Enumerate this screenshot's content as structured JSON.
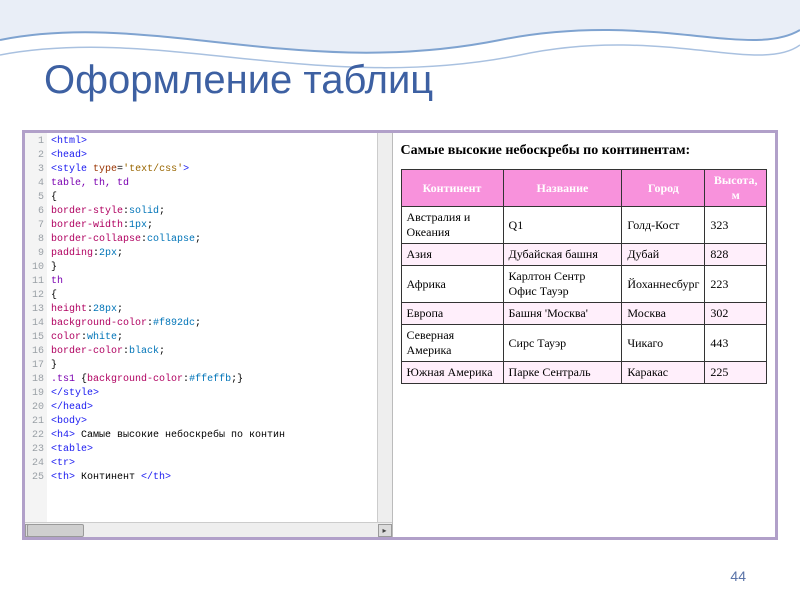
{
  "title": "Оформление таблиц",
  "page_number": "44",
  "code_lines": [
    {
      "n": "1",
      "html": "<span class='tag'>&lt;html&gt;</span>"
    },
    {
      "n": "2",
      "html": "<span class='tag'>&lt;head&gt;</span>"
    },
    {
      "n": "3",
      "html": "<span class='tag'>&lt;style</span> <span class='attr'>type</span>=<span class='str'>'text/css'</span><span class='tag'>&gt;</span>"
    },
    {
      "n": "4",
      "html": "<span class='sel'>table, th, td</span>"
    },
    {
      "n": "5",
      "html": "{"
    },
    {
      "n": "6",
      "html": "<span class='prop'>border-style</span>:<span class='val'>solid</span>;"
    },
    {
      "n": "7",
      "html": "<span class='prop'>border-width</span>:<span class='val'>1px</span>;"
    },
    {
      "n": "8",
      "html": "<span class='prop'>border-collapse</span>:<span class='val'>collapse</span>;"
    },
    {
      "n": "9",
      "html": "<span class='prop'>padding</span>:<span class='val'>2px</span>;"
    },
    {
      "n": "10",
      "html": "}"
    },
    {
      "n": "11",
      "html": "<span class='sel'>th</span>"
    },
    {
      "n": "12",
      "html": "{"
    },
    {
      "n": "13",
      "html": "<span class='prop'>height</span>:<span class='val'>28px</span>;"
    },
    {
      "n": "14",
      "html": "<span class='prop'>background-color</span>:<span class='val'>#f892dc</span>;"
    },
    {
      "n": "15",
      "html": "<span class='prop'>color</span>:<span class='val'>white</span>;"
    },
    {
      "n": "16",
      "html": "<span class='prop'>border-color</span>:<span class='val'>black</span>;"
    },
    {
      "n": "17",
      "html": "}"
    },
    {
      "n": "18",
      "html": "<span class='sel'>.ts1</span> {<span class='prop'>background-color</span>:<span class='val'>#ffeffb</span>;}"
    },
    {
      "n": "19",
      "html": "<span class='tag'>&lt;/style&gt;</span>"
    },
    {
      "n": "20",
      "html": "<span class='tag'>&lt;/head&gt;</span>"
    },
    {
      "n": "21",
      "html": "<span class='tag'>&lt;body&gt;</span>"
    },
    {
      "n": "22",
      "html": "<span class='tag'>&lt;h4&gt;</span><span class='txt'> Самые высокие небоскребы по контин</span>"
    },
    {
      "n": "23",
      "html": "<span class='tag'>&lt;table&gt;</span>"
    },
    {
      "n": "24",
      "html": "<span class='tag'>&lt;tr&gt;</span>"
    },
    {
      "n": "25",
      "html": "<span class='tag'>&lt;th&gt;</span><span class='txt'> Континент </span><span class='tag'>&lt;/th&gt;</span>"
    }
  ],
  "render": {
    "heading": "Самые высокие небоскребы по континентам:",
    "headers": [
      "Континент",
      "Название",
      "Город",
      "Высота, м"
    ],
    "rows": [
      {
        "cls": "",
        "cells": [
          "Австралия и Океания",
          "Q1",
          "Голд-Кост",
          "323"
        ]
      },
      {
        "cls": "ts1",
        "cells": [
          "Азия",
          "Дубайская башня",
          "Дубай",
          "828"
        ]
      },
      {
        "cls": "",
        "cells": [
          "Африка",
          "Карлтон Сентр Офис Тауэр",
          "Йоханнесбург",
          "223"
        ]
      },
      {
        "cls": "ts1",
        "cells": [
          "Европа",
          "Башня 'Москва'",
          "Москва",
          "302"
        ]
      },
      {
        "cls": "",
        "cells": [
          "Северная Америка",
          "Сирс Тауэр",
          "Чикаго",
          "443"
        ]
      },
      {
        "cls": "ts1",
        "cells": [
          "Южная Америка",
          "Парке Сентраль",
          "Каракас",
          "225"
        ]
      }
    ]
  }
}
